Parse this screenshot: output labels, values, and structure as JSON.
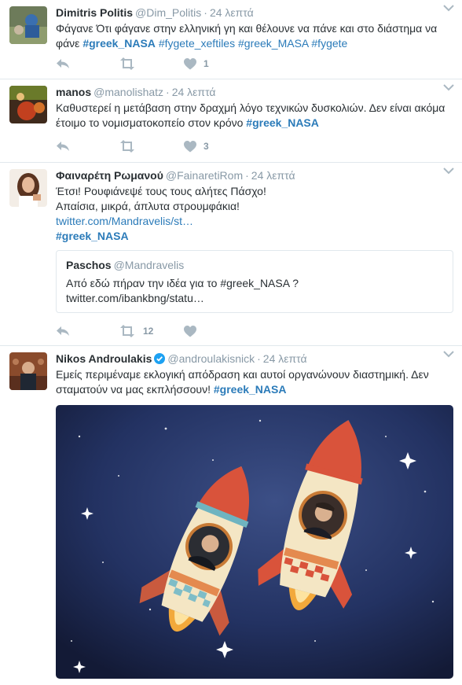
{
  "tweets": [
    {
      "name": "Dimitris Politis",
      "handle": "@Dim_Politis",
      "time": "24 λεπτά",
      "text_plain": "Φάγανε Ότι φάγανε στην ελληνική γη και θέλουνε να πάνε και στο διάστημα να φάνε",
      "hashtags": [
        "#greek_NASA",
        "#fygete_xeftiles",
        "#greek_MASA",
        "#fygete"
      ],
      "likes": "1"
    },
    {
      "name": "manos",
      "handle": "@manolishatz",
      "time": "24 λεπτά",
      "text_plain": "Καθυστερεί η μετάβαση στην δραχμή λόγο τεχνικών δυσκολιών. Δεν είναι ακόμα έτοιμο το νομισματοκοπείο στον κρόνο",
      "hashtag": "#greek_NASA",
      "likes": "3"
    },
    {
      "name": "Φαιναρέτη Ρωμανού",
      "handle": "@FainaretiRom",
      "time": "24 λεπτά",
      "line1": "Έτσι! Ρουφιάνεψέ τους τους αλήτες Πάσχο!",
      "line2": "Απαίσια, μικρά, άπλυτα στρουμφάκια!",
      "link": "twitter.com/Mandravelis/st…",
      "hashtag": "#greek_NASA",
      "retweets": "12",
      "quote": {
        "name": "Paschos",
        "handle": "@Mandravelis",
        "text": "Από εδώ πήραν την ιδέα για το #greek_NASA ?",
        "link": "twitter.com/ibankbng/statu…"
      }
    },
    {
      "name": "Nikos Androulakis",
      "handle": "@androulakisnick",
      "time": "24 λεπτά",
      "text_plain": "Εμείς περιμέναμε εκλογική απόδραση και αυτοί οργανώνουν διαστημική. Δεν σταματούν να μας εκπλήσσουν!",
      "hashtag": "#greek_NASA"
    }
  ],
  "colors": {
    "link": "#2b7bb9",
    "muted": "#8899a6",
    "border": "#e1e8ed",
    "verified": "#1da1f2",
    "rocket_red": "#d9533b",
    "space_bg": "#1f2a4d"
  },
  "icons": [
    "reply-icon",
    "retweet-icon",
    "like-icon",
    "caret-down-icon",
    "verified-icon"
  ]
}
